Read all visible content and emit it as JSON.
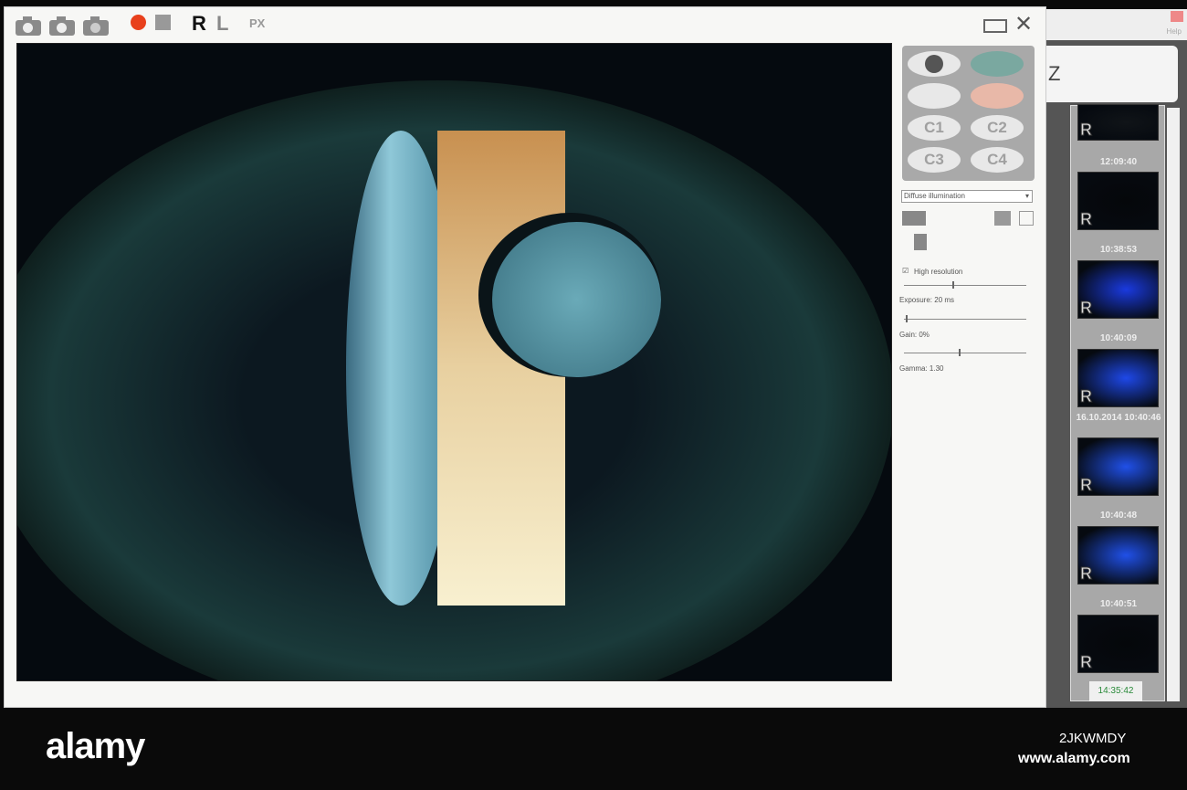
{
  "toolbar": {
    "eye_right": "R",
    "eye_left": "L",
    "mode": "PX",
    "record_color": "#e8401c"
  },
  "eye_selector": {
    "buttons": [
      "C1",
      "C2",
      "C3",
      "C4"
    ]
  },
  "settings": {
    "illumination": "Diffuse illumination",
    "high_resolution_label": "High resolution",
    "high_resolution": true,
    "exposure_label": "Exposure: 20 ms",
    "exposure_pos": 0.4,
    "gain_label": "Gain: 0%",
    "gain_pos": 0.0,
    "gamma_label": "Gamma: 1.30",
    "gamma_pos": 0.45
  },
  "side_window": {
    "header_letter": "Z",
    "help": "Help"
  },
  "thumbnails": [
    {
      "label": "R",
      "time": "12:09:40",
      "color": "#101418"
    },
    {
      "label": "R",
      "time": "10:38:53",
      "color": "#05070a"
    },
    {
      "label": "R",
      "time": "10:40:09",
      "color": "#1a3adf"
    },
    {
      "label": "R",
      "time": "16.10.2014 10:40:46",
      "color": "#1e48e8"
    },
    {
      "label": "R",
      "time": "10:40:48",
      "color": "#2050e8"
    },
    {
      "label": "R",
      "time": "10:40:51",
      "color": "#2050e8"
    },
    {
      "label": "R",
      "time": "",
      "color": "#05070a"
    }
  ],
  "current_time": "14:35:42",
  "watermark": {
    "logo": "alamy",
    "id": "2JKWMDY",
    "url": "www.alamy.com"
  }
}
